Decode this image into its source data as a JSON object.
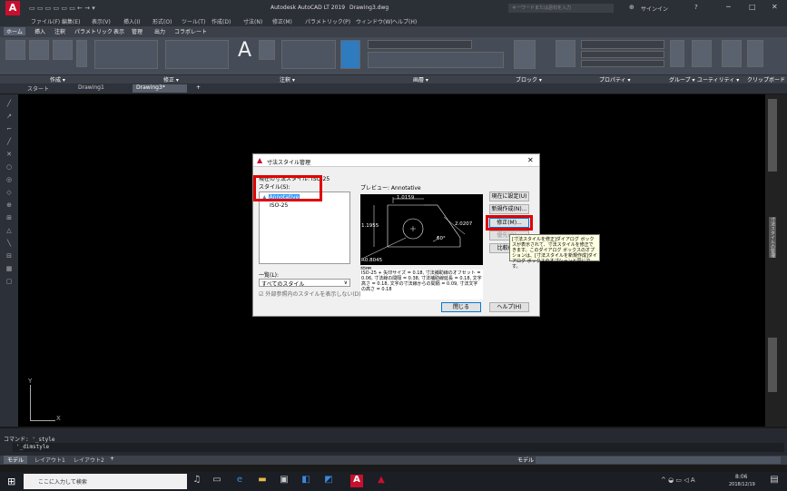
{
  "app": {
    "title": "Autodesk AutoCAD LT 2019",
    "document": "Drawing3.dwg",
    "search_placeholder": "キーワードまたは語句を入力",
    "signin": "サインイン",
    "window_controls": [
      "─",
      "□",
      "✕"
    ]
  },
  "menu": [
    "ファイル(F)",
    "編集(E)",
    "表示(V)",
    "挿入(I)",
    "形式(O)",
    "ツール(T)",
    "作成(D)",
    "寸法(N)",
    "修正(M)",
    "パラメトリック(P)",
    "ウィンドウ(W)",
    "ヘルプ(H)"
  ],
  "ribbon_tabs": [
    "ホーム",
    "挿入",
    "注釈",
    "パラメトリック",
    "表示",
    "管理",
    "出力",
    "コラボレート"
  ],
  "panels": [
    "作成 ▾",
    "修正 ▾",
    "注釈 ▾",
    "画層 ▾",
    "ブロック ▾",
    "プロパティ ▾",
    "グループ ▾",
    "ユーティリティ ▾",
    "クリップボード"
  ],
  "doc_tabs": [
    "スタート",
    "Drawing1",
    "Drawing3*"
  ],
  "dialog": {
    "title": "寸法スタイル管理",
    "current_style_label": "現在の寸法スタイル: ISO-25",
    "styles_label": "スタイル(S):",
    "styles": [
      "Annotative",
      "ISO-25"
    ],
    "preview_label": "プレビュー: Annotative",
    "list_label": "一覧(L):",
    "list_value": "すべてのスタイル",
    "xref_checkbox": "外部参照内のスタイルを表示しない(D)",
    "buttons": {
      "set_current": "現在に設定(U)",
      "new": "新規作成(N)...",
      "modify": "修正(M)...",
      "override": "優先(O)...",
      "compare": "比較(C)...",
      "close": "閉じる",
      "help": "ヘルプ(H)"
    },
    "description_label": "説明",
    "description": "ISO-25 + 矢印サイズ = 0.18, 寸法補助線のオフセット = 0.06, 寸法線の間隔 = 0.38, 寸法補助線延長 = 0.18, 文字高さ = 0.18, 文字の寸法線からの間隔 = 0.09, 寸法文字の高さ = 0.18",
    "preview_dims": [
      "1.0159",
      "1.1955",
      "2.0207",
      "60°",
      "R0.8045"
    ],
    "tooltip": "[寸法スタイルを修正]ダイアログ ボックスが表示されて、寸法スタイルを修正できます。このダイアログ ボックスのオプションは、[寸法スタイルを新規作成]ダイアログ ボックスのオプションと同じです。"
  },
  "command_history": "コマンド: '_style",
  "command_line": "'_dimstyle",
  "layout_tabs": [
    "モデル",
    "レイアウト1",
    "レイアウト2"
  ],
  "status_model": "モデル",
  "taskbar": {
    "search": "ここに入力して検索",
    "time": "8:06",
    "date": "2018/12/19"
  },
  "right_palette": "寸法スタイルの管理",
  "ucs": {
    "y": "Y",
    "x": "X"
  }
}
